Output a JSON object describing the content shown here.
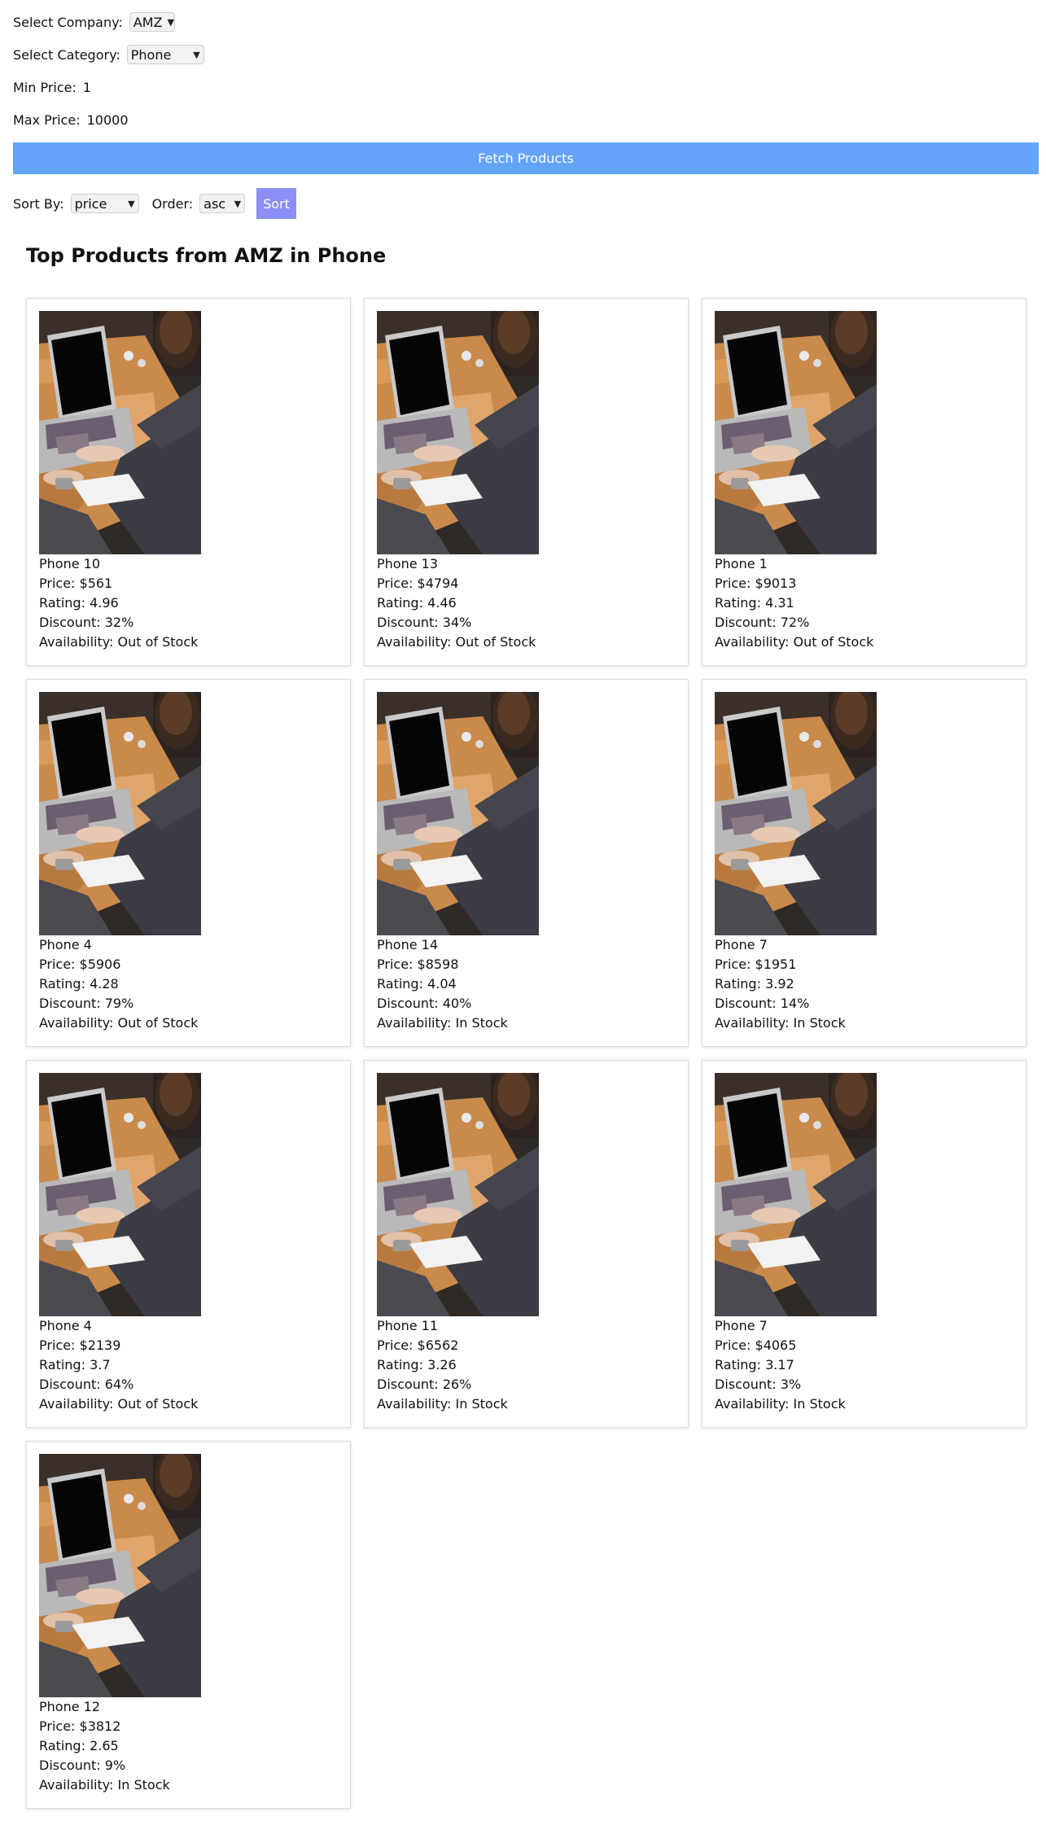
{
  "filters": {
    "company_label": "Select Company:",
    "company_value": "AMZ",
    "category_label": "Select Category:",
    "category_value": "Phone",
    "min_price_label": "Min Price:",
    "min_price_value": "1",
    "max_price_label": "Max Price:",
    "max_price_value": "10000",
    "fetch_label": "Fetch Products"
  },
  "sort": {
    "sort_by_label": "Sort By:",
    "sort_by_value": "price",
    "order_label": "Order:",
    "order_value": "asc",
    "sort_button_label": "Sort"
  },
  "heading": "Top Products from AMZ in Phone",
  "colors": {
    "fetch_button": "#63a4f9",
    "sort_button": "#8c8ff6"
  },
  "products": [
    {
      "name": "Phone 10",
      "price": "Price: $561",
      "rating": "Rating: 4.96",
      "discount": "Discount: 32%",
      "availability": "Availability: Out of Stock"
    },
    {
      "name": "Phone 13",
      "price": "Price: $4794",
      "rating": "Rating: 4.46",
      "discount": "Discount: 34%",
      "availability": "Availability: Out of Stock"
    },
    {
      "name": "Phone 1",
      "price": "Price: $9013",
      "rating": "Rating: 4.31",
      "discount": "Discount: 72%",
      "availability": "Availability: Out of Stock"
    },
    {
      "name": "Phone 4",
      "price": "Price: $5906",
      "rating": "Rating: 4.28",
      "discount": "Discount: 79%",
      "availability": "Availability: Out of Stock"
    },
    {
      "name": "Phone 14",
      "price": "Price: $8598",
      "rating": "Rating: 4.04",
      "discount": "Discount: 40%",
      "availability": "Availability: In Stock"
    },
    {
      "name": "Phone 7",
      "price": "Price: $1951",
      "rating": "Rating: 3.92",
      "discount": "Discount: 14%",
      "availability": "Availability: In Stock"
    },
    {
      "name": "Phone 4",
      "price": "Price: $2139",
      "rating": "Rating: 3.7",
      "discount": "Discount: 64%",
      "availability": "Availability: Out of Stock"
    },
    {
      "name": "Phone 11",
      "price": "Price: $6562",
      "rating": "Rating: 3.26",
      "discount": "Discount: 26%",
      "availability": "Availability: In Stock"
    },
    {
      "name": "Phone 7",
      "price": "Price: $4065",
      "rating": "Rating: 3.17",
      "discount": "Discount: 3%",
      "availability": "Availability: In Stock"
    },
    {
      "name": "Phone 12",
      "price": "Price: $3812",
      "rating": "Rating: 2.65",
      "discount": "Discount: 9%",
      "availability": "Availability: In Stock"
    }
  ]
}
